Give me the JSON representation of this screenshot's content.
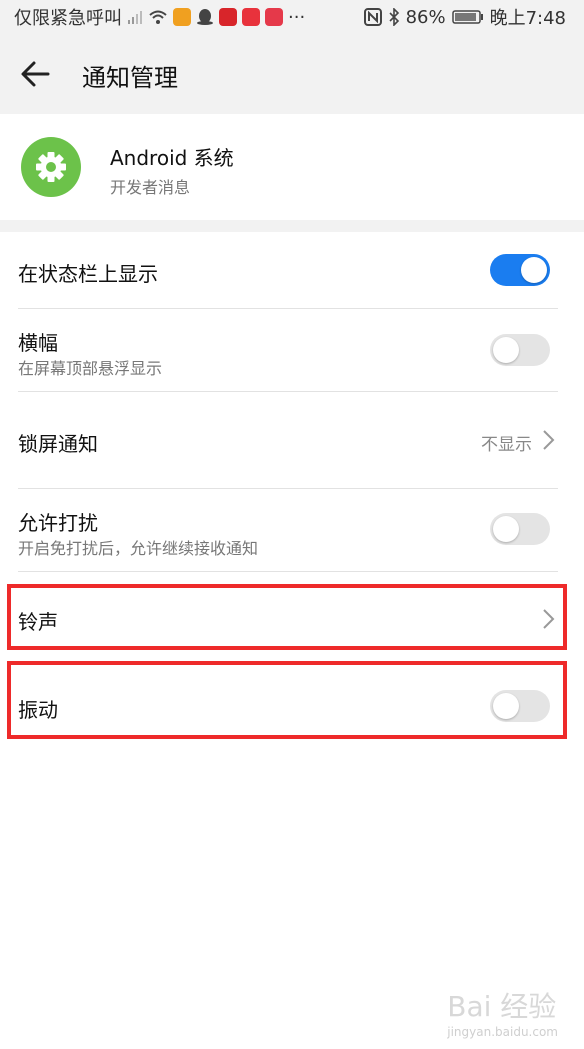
{
  "status_bar": {
    "carrier_text": "仅限紧急呼叫",
    "more": "···",
    "battery": "86%",
    "time": "晚上7:48",
    "icons": [
      "signal-icon",
      "wifi-icon",
      "app-notify-icon",
      "qq-icon",
      "news-icon",
      "app-icon",
      "huawei-store-icon",
      "nfc-icon",
      "bluetooth-icon",
      "battery-icon"
    ]
  },
  "header": {
    "title": "通知管理"
  },
  "app_card": {
    "name": "Android 系统",
    "subtitle": "开发者消息"
  },
  "settings": {
    "status_bar_show": {
      "label": "在状态栏上显示",
      "enabled": true
    },
    "banner": {
      "label": "横幅",
      "desc": "在屏幕顶部悬浮显示",
      "enabled": false
    },
    "lockscreen": {
      "label": "锁屏通知",
      "value": "不显示"
    },
    "dnd_allow": {
      "label": "允许打扰",
      "desc": "开启免打扰后，允许继续接收通知",
      "enabled": false
    },
    "ringtone": {
      "label": "铃声"
    },
    "vibrate": {
      "label": "振动",
      "enabled": false
    }
  },
  "colors": {
    "accent": "#1a7df0",
    "highlight": "#ee2a2a",
    "app_icon": "#6cc24a"
  },
  "watermark": {
    "text": "Bai 经验",
    "url": "jingyan.baidu.com"
  }
}
